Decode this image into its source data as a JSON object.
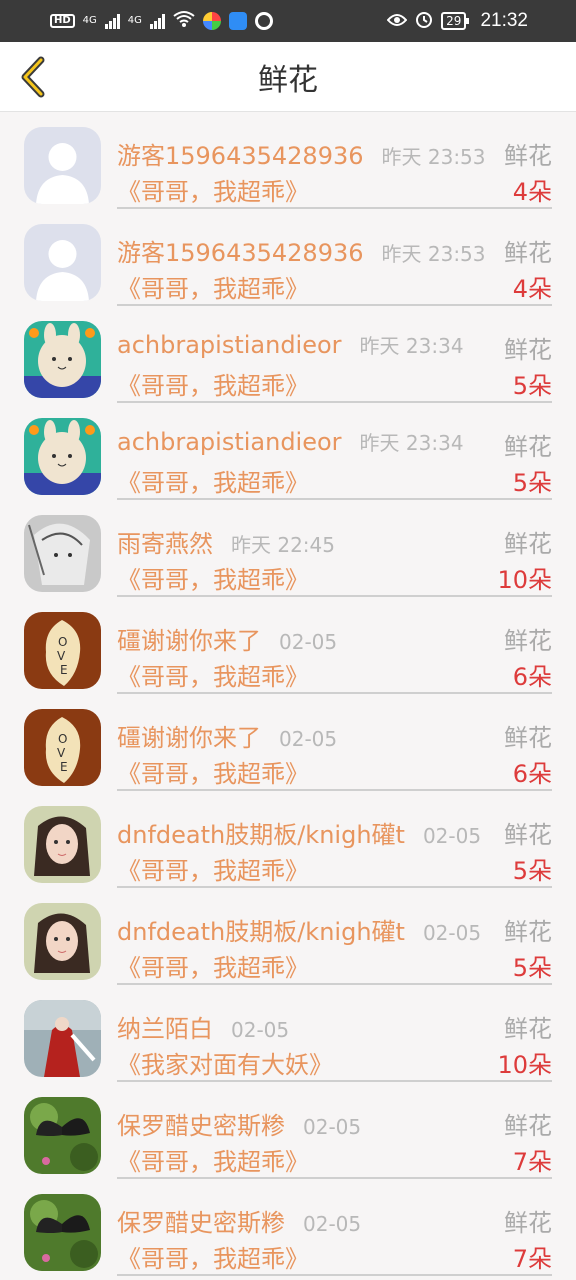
{
  "status_bar": {
    "left_badge": "HD",
    "net1": "4G",
    "net2": "4G",
    "battery": "29",
    "time": "21:32"
  },
  "header": {
    "title": "鲜花"
  },
  "rows": [
    {
      "name": "游客1596435428936",
      "time": "昨天 23:53",
      "kind": "鲜花",
      "book": "《哥哥，我超乖》",
      "count": "4朵",
      "avatar": "default-avatar"
    },
    {
      "name": "游客1596435428936",
      "time": "昨天 23:53",
      "kind": "鲜花",
      "book": "《哥哥，我超乖》",
      "count": "4朵",
      "avatar": "default-avatar"
    },
    {
      "name": "achbrapistiandieor",
      "time": "昨天 23:34",
      "kind": "鲜花",
      "book": "《哥哥，我超乖》",
      "count": "5朵",
      "avatar": "bunny-avatar"
    },
    {
      "name": "achbrapistiandieor",
      "time": "昨天 23:34",
      "kind": "鲜花",
      "book": "《哥哥，我超乖》",
      "count": "5朵",
      "avatar": "bunny-avatar"
    },
    {
      "name": "雨寄燕然",
      "time": "昨天 22:45",
      "kind": "鲜花",
      "book": "《哥哥，我超乖》",
      "count": "10朵",
      "avatar": "sketch-avatar"
    },
    {
      "name": "礓谢谢你来了",
      "time": "02-05",
      "kind": "鲜花",
      "book": "《哥哥，我超乖》",
      "count": "6朵",
      "avatar": "love-leaf-avatar"
    },
    {
      "name": "礓谢谢你来了",
      "time": "02-05",
      "kind": "鲜花",
      "book": "《哥哥，我超乖》",
      "count": "6朵",
      "avatar": "love-leaf-avatar"
    },
    {
      "name": "dnfdeath肢期板/knigh礶t",
      "time": "02-05",
      "kind": "鲜花",
      "book": "《哥哥，我超乖》",
      "count": "5朵",
      "avatar": "girl-avatar"
    },
    {
      "name": "dnfdeath肢期板/knigh礶t",
      "time": "02-05",
      "kind": "鲜花",
      "book": "《哥哥，我超乖》",
      "count": "5朵",
      "avatar": "girl-avatar"
    },
    {
      "name": "纳兰陌白",
      "time": "02-05",
      "kind": "鲜花",
      "book": "《我家对面有大妖》",
      "count": "10朵",
      "avatar": "ancient-figure-avatar"
    },
    {
      "name": "保罗醋史密斯糁",
      "time": "02-05",
      "kind": "鲜花",
      "book": "《哥哥，我超乖》",
      "count": "7朵",
      "avatar": "butterfly-avatar"
    },
    {
      "name": "保罗醋史密斯糁",
      "time": "02-05",
      "kind": "鲜花",
      "book": "《哥哥，我超乖》",
      "count": "7朵",
      "avatar": "butterfly-avatar"
    }
  ],
  "colors": {
    "name": "#e8955e",
    "count": "#dd3b3b",
    "time": "#b8b8b8",
    "back_arrow": "#f5c51b"
  }
}
